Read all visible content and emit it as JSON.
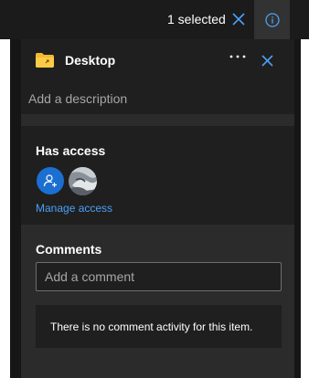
{
  "topbar": {
    "selected_label": "1 selected",
    "clear_selection_icon": "close-icon",
    "info_icon": "info-icon"
  },
  "panel": {
    "item_icon": "folder-icon",
    "item_title": "Desktop",
    "more_icon": "more-options-icon",
    "close_icon": "close-icon",
    "description_placeholder": "Add a description",
    "has_access": {
      "title": "Has access",
      "manage_link": "Manage access"
    },
    "comments": {
      "title": "Comments",
      "input_placeholder": "Add a comment",
      "empty_message": "There is no comment activity for this item."
    }
  },
  "colors": {
    "accent": "#4aa0f5",
    "avatar_blue": "#1b6fd1",
    "panel_bg": "#2b2b2b",
    "card_bg": "#1f1f1f"
  }
}
